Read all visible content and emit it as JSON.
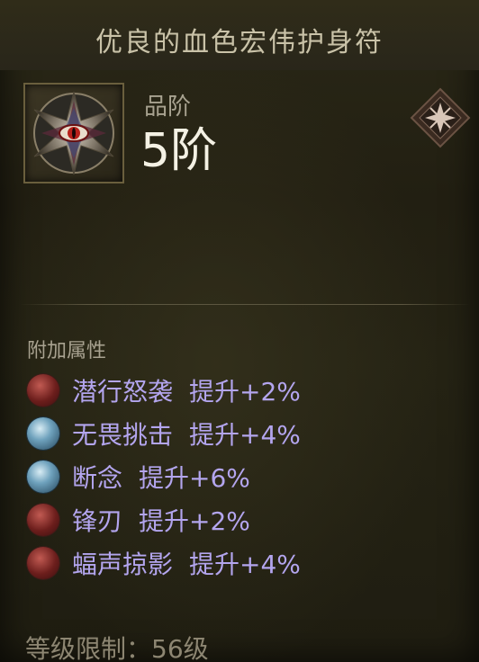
{
  "item": {
    "title": "优良的血色宏伟护身符",
    "icon": "amulet-eye-icon"
  },
  "rank": {
    "label": "品阶",
    "value": "5阶",
    "emblem_icon": "star-emblem-icon"
  },
  "affixes": {
    "heading": "附加属性",
    "items": [
      {
        "name": "潜行怒袭",
        "bonus": "提升+2%",
        "icon": "red-skill-icon"
      },
      {
        "name": "无畏挑击",
        "bonus": "提升+4%",
        "icon": "blue-skill-icon"
      },
      {
        "name": "断念",
        "bonus": "提升+6%",
        "icon": "blue-skill-icon"
      },
      {
        "name": "锋刃",
        "bonus": "提升+2%",
        "icon": "red-skill-icon"
      },
      {
        "name": "蝠声掠影",
        "bonus": "提升+4%",
        "icon": "red-skill-icon"
      }
    ]
  },
  "requirement": {
    "text": "等级限制：56级"
  },
  "colors": {
    "title": "#c9c2a8",
    "rank_value": "#f4f1e4",
    "affix_text": "#b3a5ee",
    "muted": "#a8a290"
  }
}
